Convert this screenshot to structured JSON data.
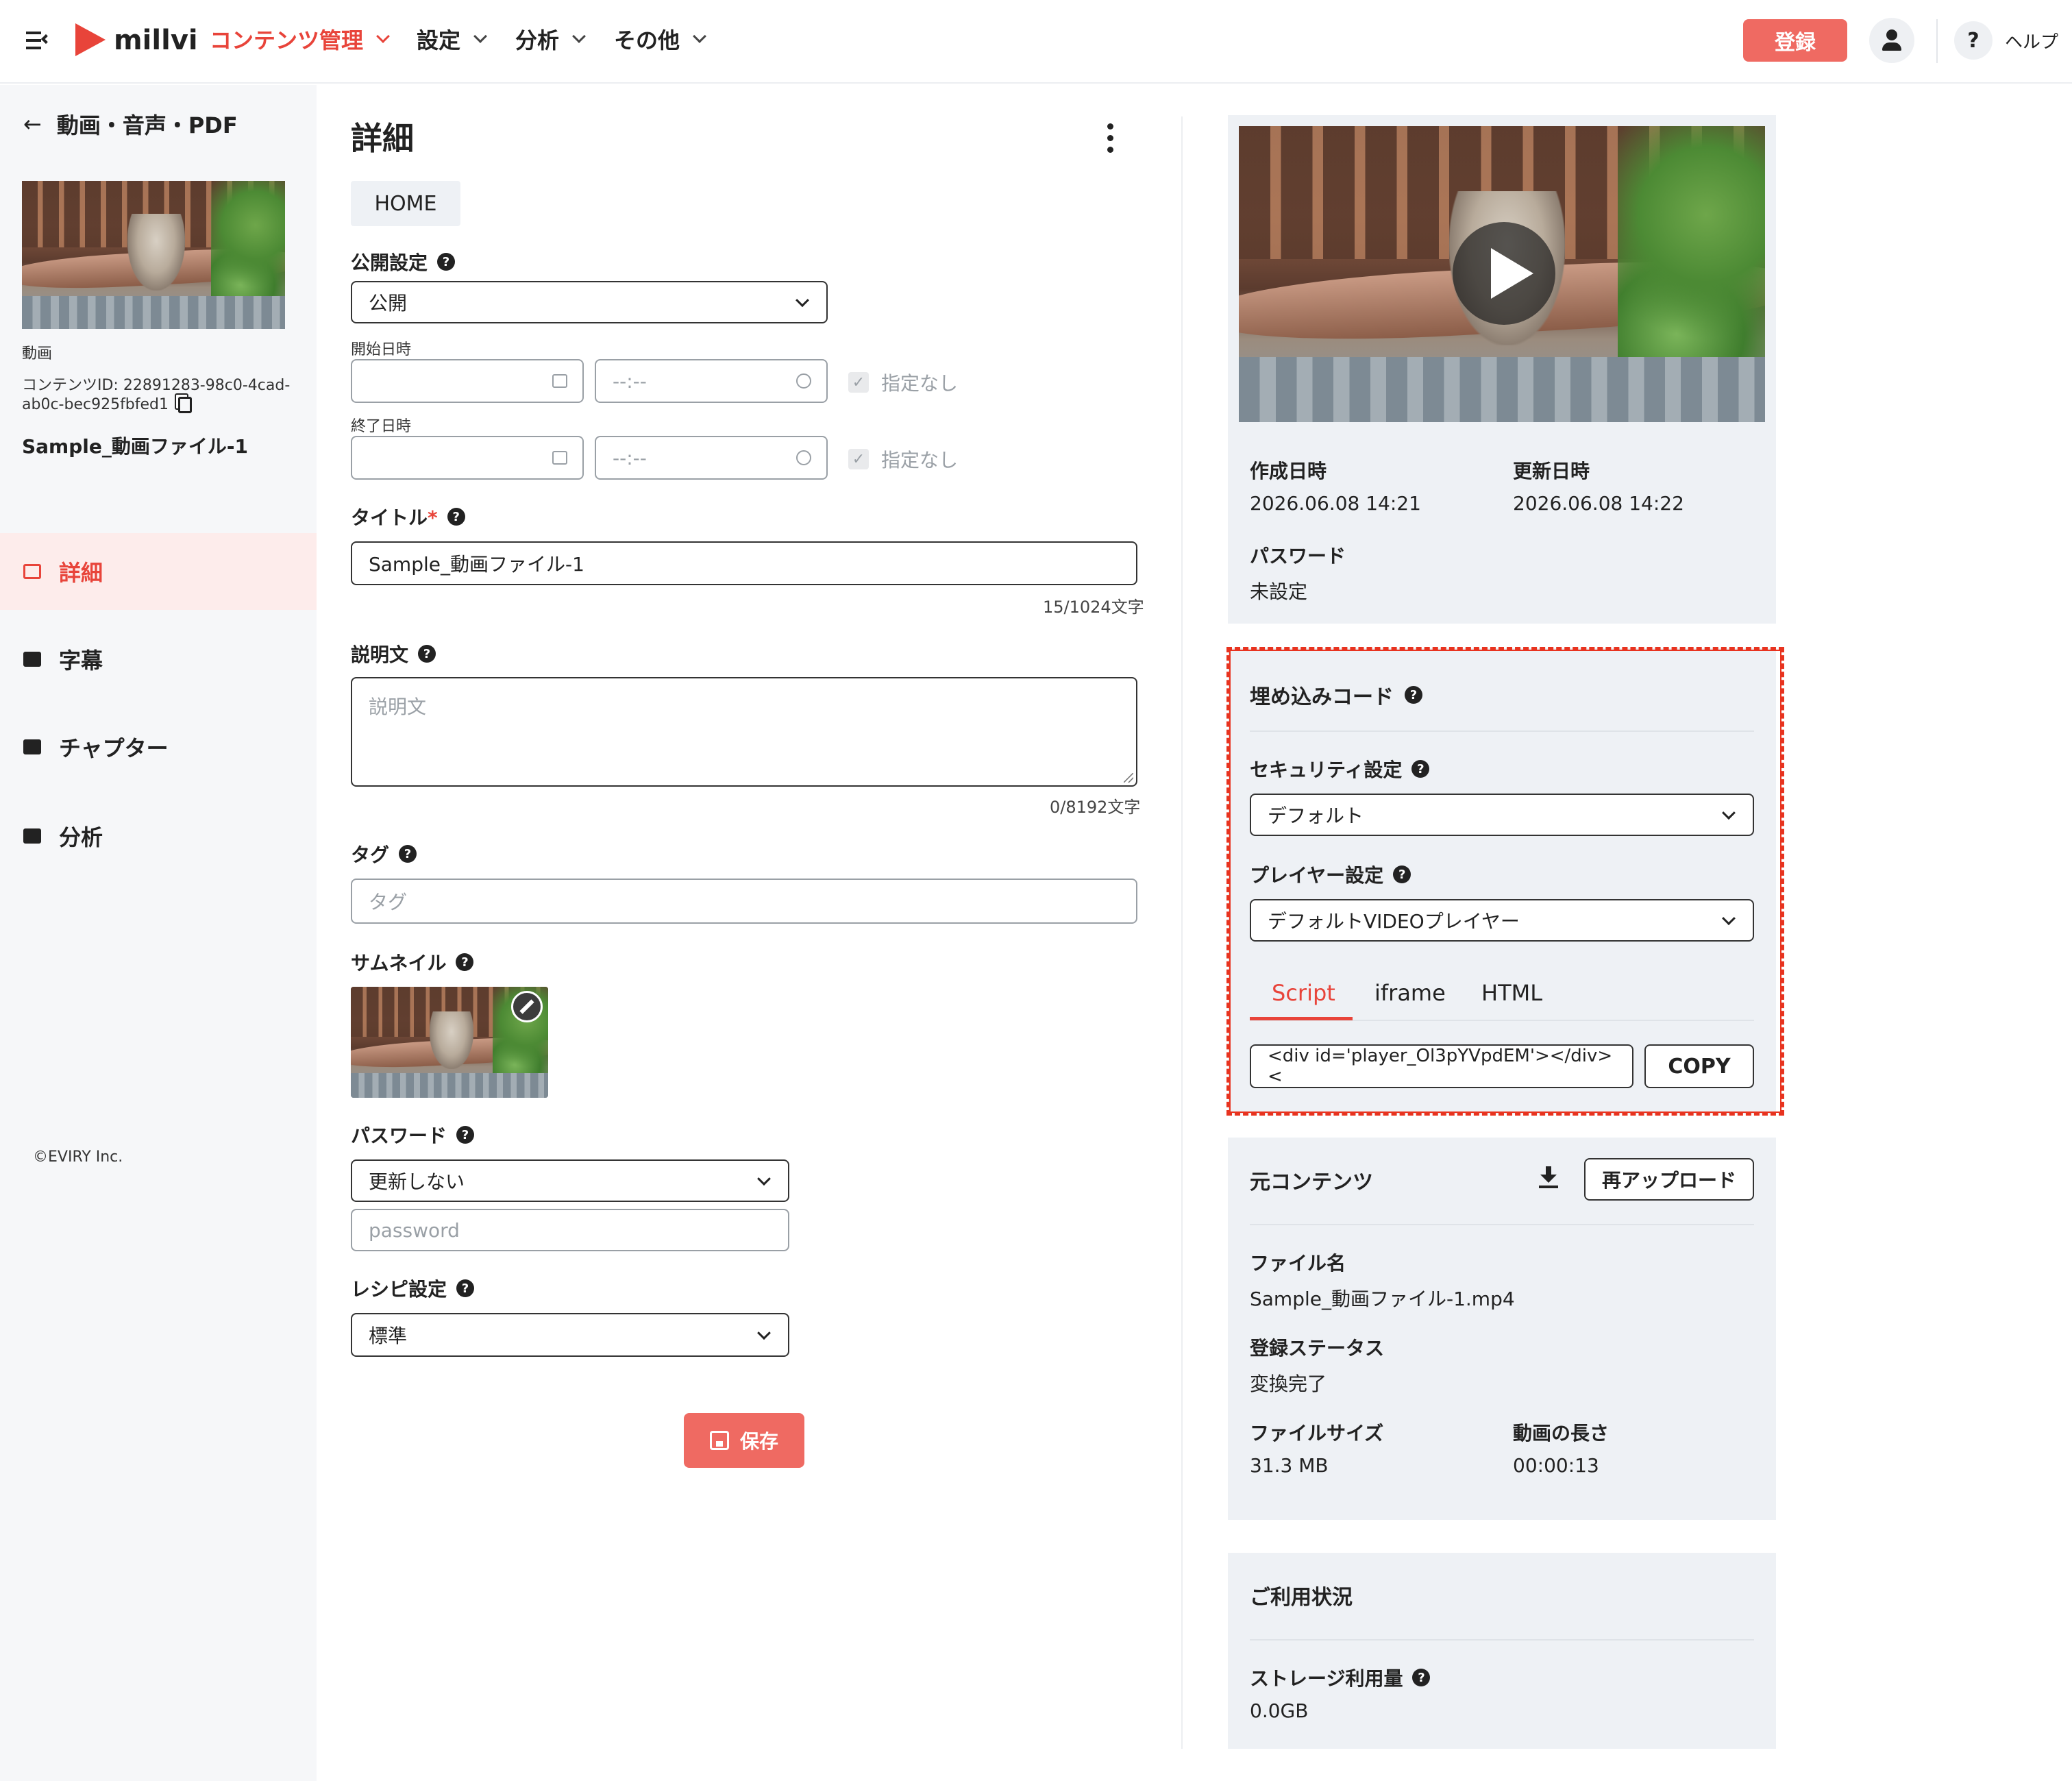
{
  "header": {
    "brand": "millvi",
    "nav": [
      {
        "label": "コンテンツ管理",
        "active": true
      },
      {
        "label": "設定",
        "active": false
      },
      {
        "label": "分析",
        "active": false
      },
      {
        "label": "その他",
        "active": false
      }
    ],
    "register_label": "登録",
    "help_label": "ヘルプ",
    "accent_color": "#e8443a"
  },
  "sidebar": {
    "back_label": "動画・音声・PDF",
    "media_type": "動画",
    "content_id_label": "コンテンツID: 22891283-98c0-4cad-",
    "content_id_cont": "ab0c-bec925fbfed1",
    "content_title": "Sample_動画ファイル-1",
    "items": [
      {
        "label": "詳細",
        "icon": "gear-icon",
        "active": true
      },
      {
        "label": "字幕",
        "icon": "subtitles-icon",
        "active": false
      },
      {
        "label": "チャプター",
        "icon": "chapter-icon",
        "active": false
      },
      {
        "label": "分析",
        "icon": "chart-icon",
        "active": false
      }
    ],
    "copyright": "©EVIRY Inc."
  },
  "main": {
    "title": "詳細",
    "breadcrumb": "HOME",
    "publish": {
      "label": "公開設定",
      "value": "公開"
    },
    "start": {
      "label": "開始日時",
      "time_placeholder": "--:--",
      "none_label": "指定なし"
    },
    "end": {
      "label": "終了日時",
      "time_placeholder": "--:--",
      "none_label": "指定なし"
    },
    "title_field": {
      "label": "タイトル",
      "required_mark": "*",
      "value": "Sample_動画ファイル-1",
      "counter": "15/1024文字"
    },
    "description": {
      "label": "説明文",
      "placeholder": "説明文",
      "counter": "0/8192文字"
    },
    "tag": {
      "label": "タグ",
      "placeholder": "タグ"
    },
    "thumbnail": {
      "label": "サムネイル"
    },
    "password": {
      "label": "パスワード",
      "select_value": "更新しない",
      "placeholder": "password"
    },
    "recipe": {
      "label": "レシピ設定",
      "value": "標準"
    },
    "save_label": "保存"
  },
  "right": {
    "created_label": "作成日時",
    "created_value": "2026.06.08 14:21",
    "updated_label": "更新日時",
    "updated_value": "2026.06.08 14:22",
    "password_label": "パスワード",
    "password_value": "未設定",
    "embed": {
      "title": "埋め込みコード",
      "security_label": "セキュリティ設定",
      "security_value": "デフォルト",
      "player_label": "プレイヤー設定",
      "player_value": "デフォルトVIDEOプレイヤー",
      "tabs": [
        {
          "label": "Script",
          "active": true
        },
        {
          "label": "iframe",
          "active": false
        },
        {
          "label": "HTML",
          "active": false
        }
      ],
      "code": "<div id='player_Ol3pYVpdEM'></div>  <",
      "copy_label": "COPY"
    },
    "source": {
      "title": "元コンテンツ",
      "reupload_label": "再アップロード",
      "filename_label": "ファイル名",
      "filename_value": "Sample_動画ファイル-1.mp4",
      "status_label": "登録ステータス",
      "status_value": "変換完了",
      "size_label": "ファイルサイズ",
      "size_value": "31.3 MB",
      "duration_label": "動画の長さ",
      "duration_value": "00:00:13"
    },
    "usage": {
      "title": "ご利用状況",
      "storage_label": "ストレージ利用量",
      "storage_value": "0.0GB"
    }
  }
}
